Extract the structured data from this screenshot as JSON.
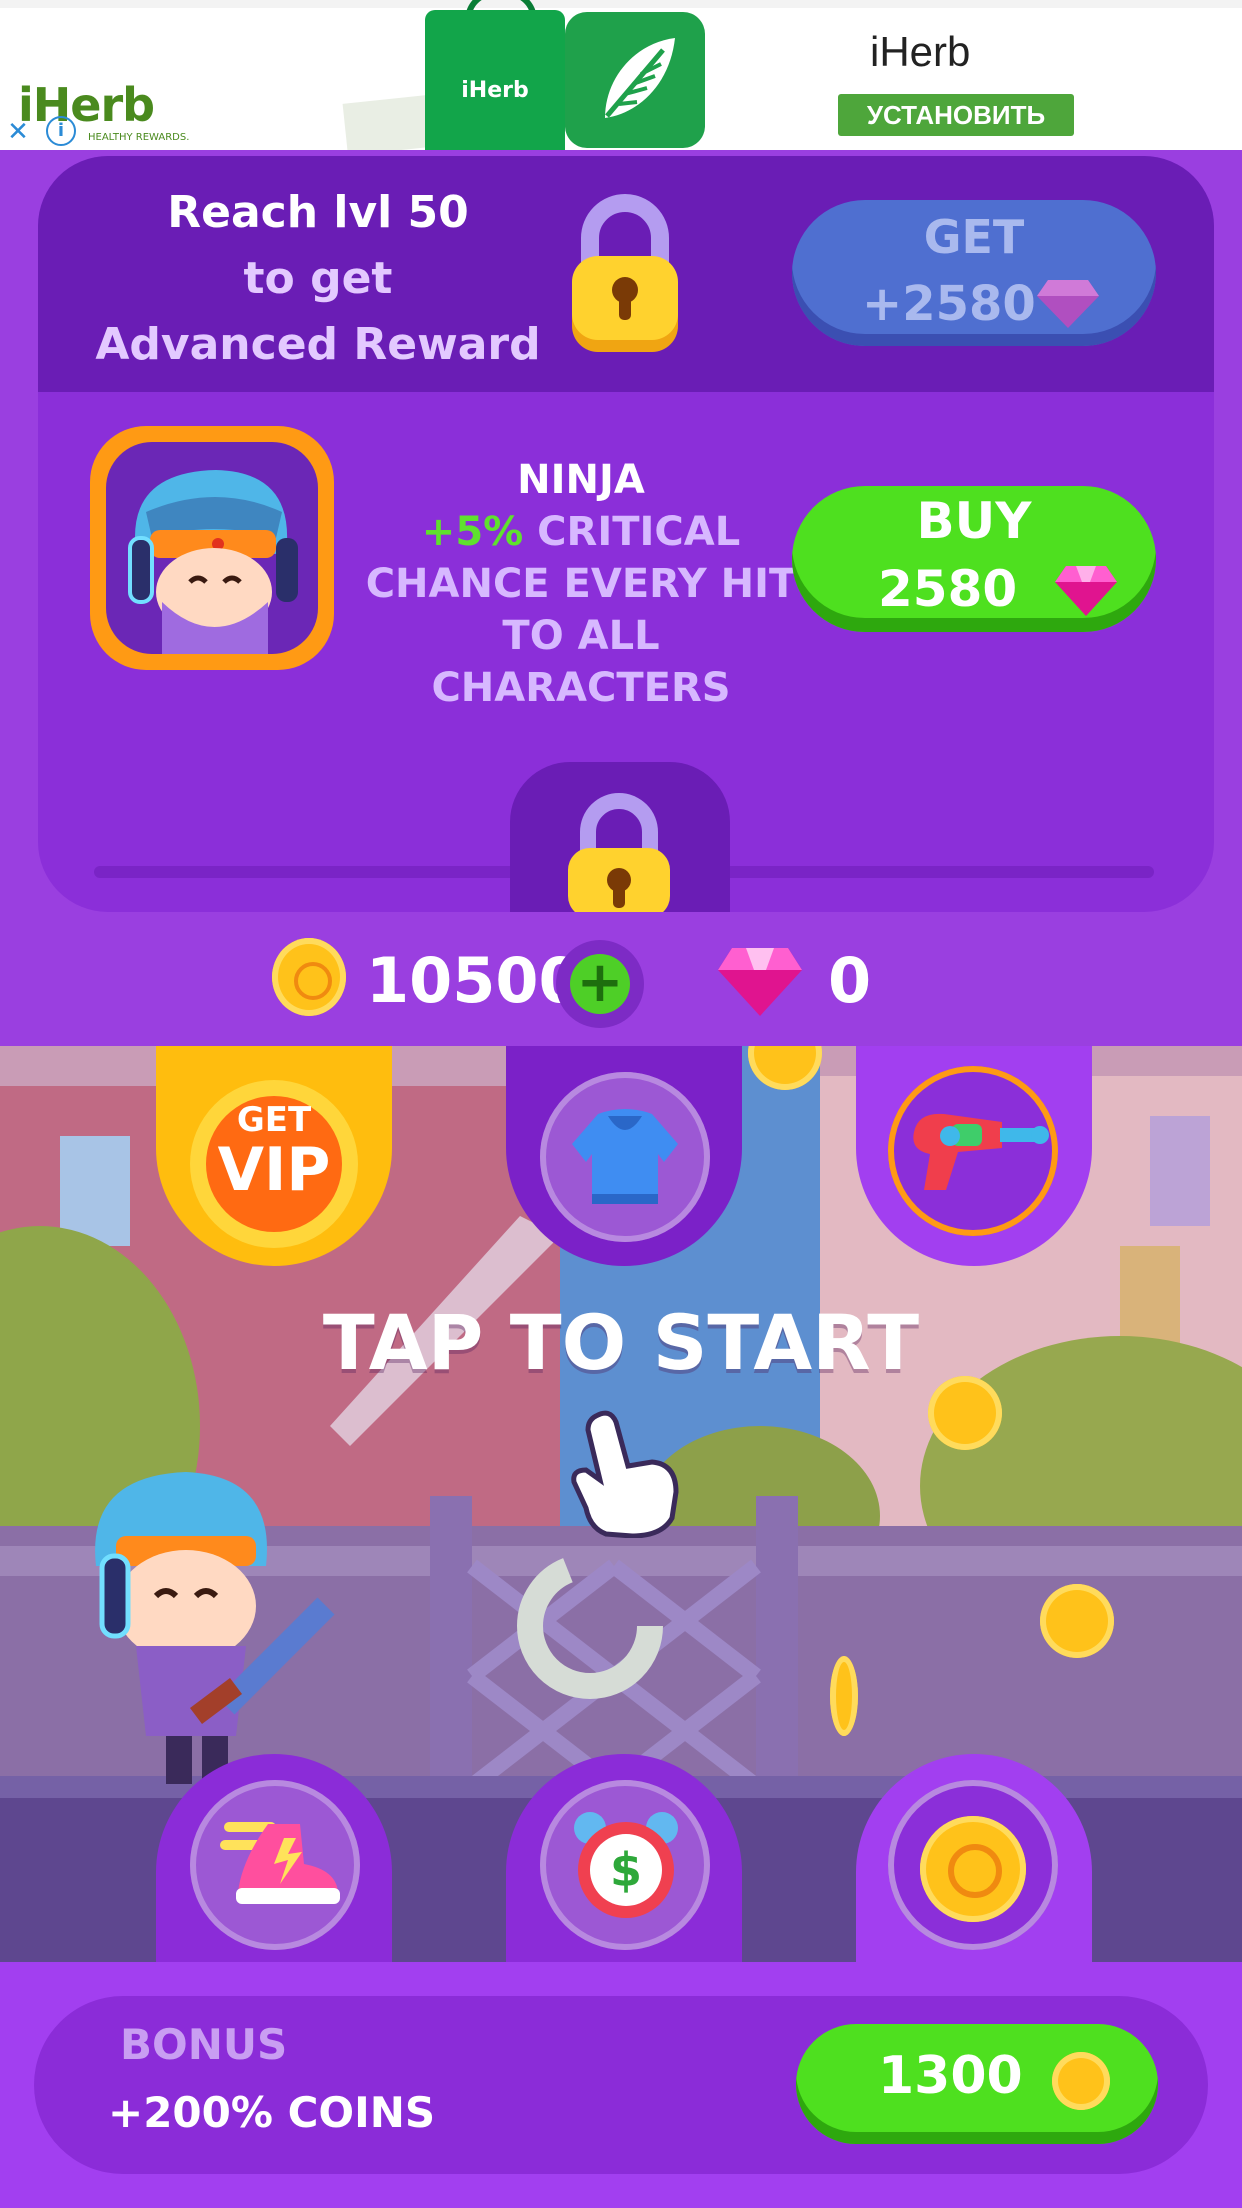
{
  "ad": {
    "logo": "iHerb",
    "tagline": "HEALTHY REWARDS.",
    "bag_label": "iHerb",
    "brand": "iHerb",
    "install_label": "УСТАНОВИТЬ"
  },
  "reward": {
    "line1": "Reach lvl 50",
    "line2": "to get",
    "line3": "Advanced Reward",
    "get_label": "GET",
    "get_amount": "+2580"
  },
  "character": {
    "name": "NINJA",
    "percent": "+5%",
    "perk_line1": "CRITICAL",
    "perk_line2": "CHANCE EVERY HIT",
    "perk_line3": "TO ALL CHARACTERS",
    "buy_label": "BUY",
    "price": "2580"
  },
  "currency": {
    "coins": "10500",
    "gems": "0"
  },
  "scene": {
    "vip_line1": "GET",
    "vip_line2": "VIP",
    "tap_to_start": "TAP TO START"
  },
  "bonus": {
    "title": "BONUS",
    "subtitle": "+200%  COINS",
    "price": "1300"
  },
  "colors": {
    "panel": "#8b2fd9",
    "panel_dark": "#6a1db5",
    "green": "#4ee01f",
    "gold": "#ffc21a",
    "gem": "#ff3fc6"
  }
}
